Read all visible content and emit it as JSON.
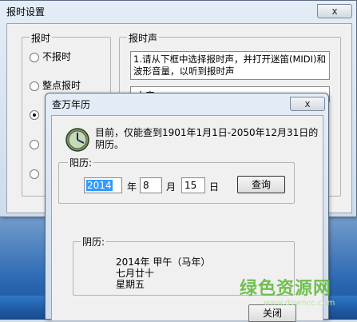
{
  "back_window": {
    "title": "报时设置",
    "close_label": "x",
    "group_mode": {
      "legend": "报时",
      "options": [
        {
          "label": "不报时",
          "checked": false
        },
        {
          "label": "整点报时",
          "checked": false
        },
        {
          "label": "",
          "checked": true
        },
        {
          "label": "",
          "checked": false
        },
        {
          "label": "",
          "checked": false
        }
      ]
    },
    "group_sound": {
      "legend": "报时声",
      "hint": "1.请从下框中选择报时声，并打开迷笛(MIDI)和波形音量，以听到报时声",
      "select_value": "中音"
    }
  },
  "front_window": {
    "title": "查万年历",
    "close_label": "x",
    "info_text": "目前，仅能查到1901年1月1日-2050年12月31日的阴历。",
    "solar_group": {
      "legend": "阳历:",
      "year_value": "2014",
      "year_unit": "年",
      "month_value": "8",
      "month_unit": "月",
      "day_value": "15",
      "day_unit": "日",
      "query_label": "查询"
    },
    "lunar_group": {
      "legend": "阴历:",
      "line1": "2014年  甲午（马年）",
      "line2": "七月廿十",
      "line3": "星期五"
    },
    "close_button_label": "关闭"
  },
  "watermark": {
    "text": "绿色资源网",
    "url": "www.downcc.com"
  },
  "colors": {
    "selection": "#3399ff",
    "watermark": "#5ab832"
  }
}
